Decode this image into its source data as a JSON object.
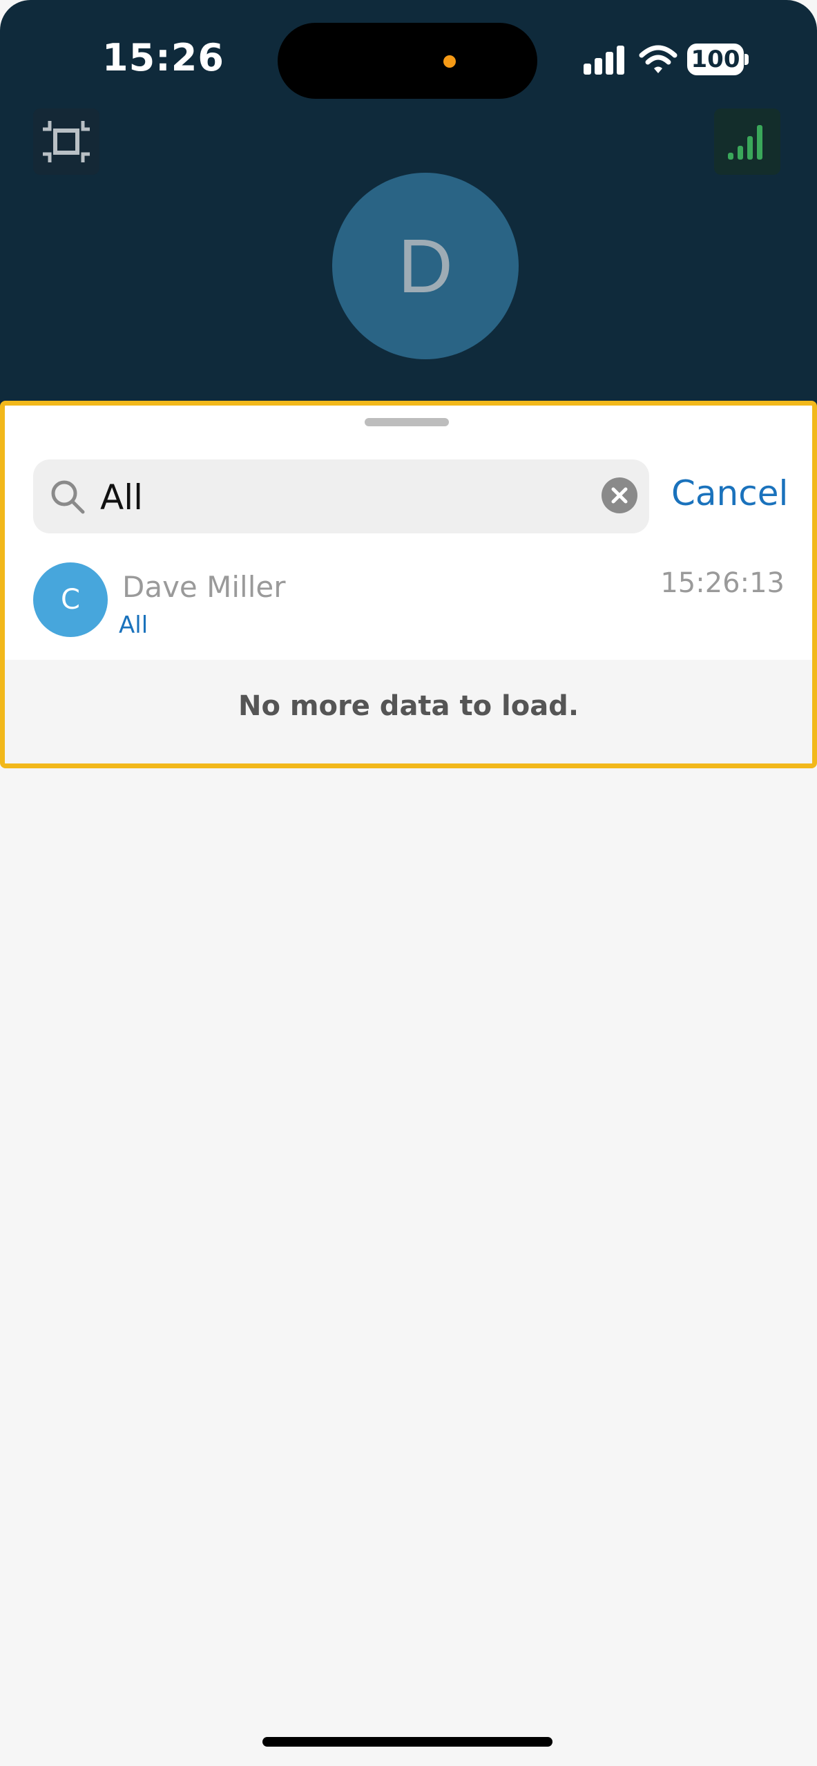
{
  "status_bar": {
    "time": "15:26",
    "battery": "100",
    "colors": {
      "island_dot": "#f59a16"
    }
  },
  "header": {
    "avatar_letter": "D",
    "left_button_icon": "crop-icon",
    "right_button_icon": "signal-strength-icon",
    "colors": {
      "background": "#0f2a3b",
      "avatar": "#2a6485",
      "signal": "#3aa75a"
    }
  },
  "sheet": {
    "highlight_color": "#f2b81b",
    "search": {
      "value": "All",
      "placeholder": "Search",
      "clear_icon": "clear-icon",
      "cancel_label": "Cancel"
    },
    "results": [
      {
        "avatar_letter": "C",
        "name": "Dave Miller",
        "subtitle": "All",
        "time": "15:26:13"
      }
    ],
    "footer_message": "No more data to load."
  }
}
